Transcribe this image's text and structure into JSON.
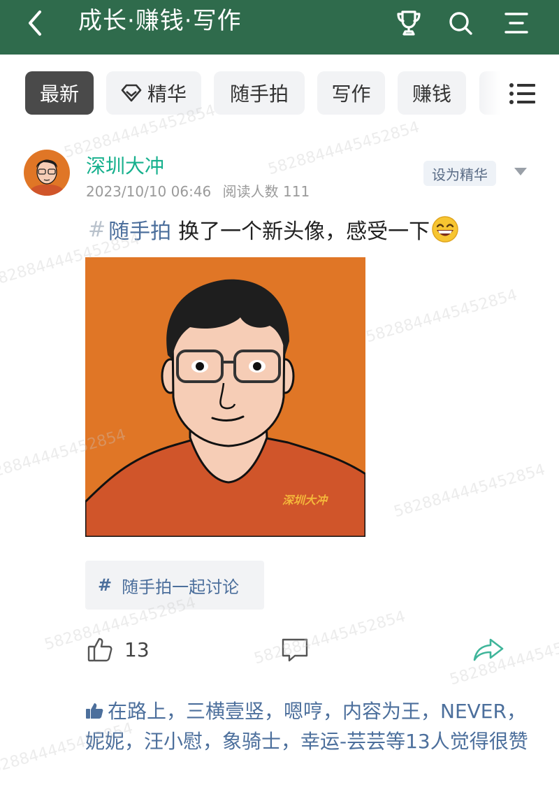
{
  "header": {
    "title": "成长·赚钱·写作",
    "icons": [
      "back-arrow-icon",
      "trophy-icon",
      "search-icon",
      "menu-icon"
    ]
  },
  "tabs": [
    {
      "label": "最新",
      "active": true
    },
    {
      "label": "精华",
      "icon": "gem-icon"
    },
    {
      "label": "随手拍"
    },
    {
      "label": "写作"
    },
    {
      "label": "赚钱"
    }
  ],
  "post": {
    "author": "深圳大冲",
    "timestamp": "2023/10/10 06:46",
    "read_label": "阅读人数 111",
    "set_essence": "设为精华",
    "hashtag": "#",
    "topic": "随手拍",
    "text": "换了一个新头像，感受一下",
    "image_caption": "深圳大冲",
    "topic_chip": {
      "hash": "#",
      "label": "随手拍一起讨论"
    }
  },
  "actions": {
    "like_count": "13"
  },
  "likers": {
    "names": "在路上，三横壹竖，嗯哼，内容为王，NEVER，妮妮，汪小慰，象骑士，幸运-芸芸",
    "tail": "等13人觉得很赞"
  },
  "watermark": "5828844445452854",
  "colors": {
    "header_bg": "#2f6b4c",
    "author": "#16b08d",
    "link": "#4c6f9c",
    "image_bg": "#e07626",
    "shirt": "#d0552a",
    "share": "#3fb59a"
  }
}
